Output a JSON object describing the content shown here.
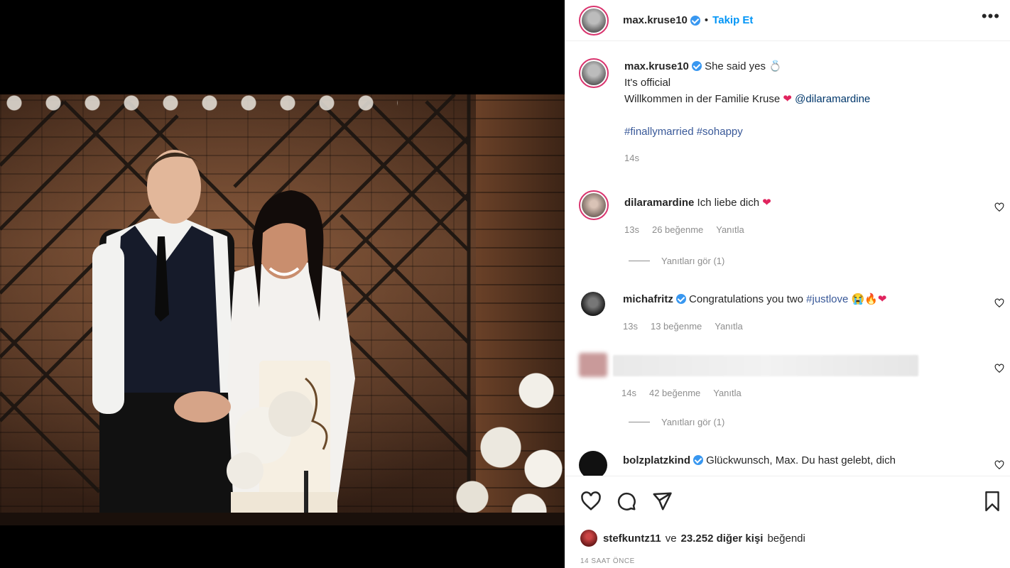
{
  "post": {
    "author": "max.kruse10",
    "follow_label": "Takip Et",
    "dot": "•",
    "more_label": "•••"
  },
  "caption": {
    "author": "max.kruse10",
    "line1": "She said yes 💍",
    "line2": "It's official",
    "line3_text": "Willkommen in der Familie Kruse",
    "line3_heart": "❤",
    "line3_mention": "@dilaramardine",
    "hashtags": "#finallymarried #sohappy",
    "time": "14s"
  },
  "comments": [
    {
      "user": "dilaramardine",
      "text": "Ich liebe dich",
      "emoji": "❤",
      "time": "13s",
      "likes": "26 beğenme",
      "reply": "Yanıtla",
      "view_replies": "Yanıtları gör (1)"
    },
    {
      "user": "michafritz",
      "text": "Congratulations you two",
      "tag": "#justlove",
      "emoji": "😭🔥❤",
      "time": "13s",
      "likes": "13 beğenme",
      "reply": "Yanıtla"
    },
    {
      "time": "14s",
      "likes": "42 beğenme",
      "reply": "Yanıtla",
      "view_replies": "Yanıtları gör (1)"
    },
    {
      "user": "bolzplatzkind",
      "text": "Glückwunsch, Max. Du hast gelebt, dich"
    }
  ],
  "footer": {
    "liker": "stefkuntz11",
    "and_text": "ve",
    "others_count": "23.252 diğer kişi",
    "liked_text": "beğendi",
    "time_ago": "14 SAAT ÖNCE"
  },
  "colors": {
    "link_blue": "#0095f6",
    "verified_blue": "#3897f0",
    "heart_red": "#e0245e",
    "muted_gray": "#8e8e8e"
  }
}
